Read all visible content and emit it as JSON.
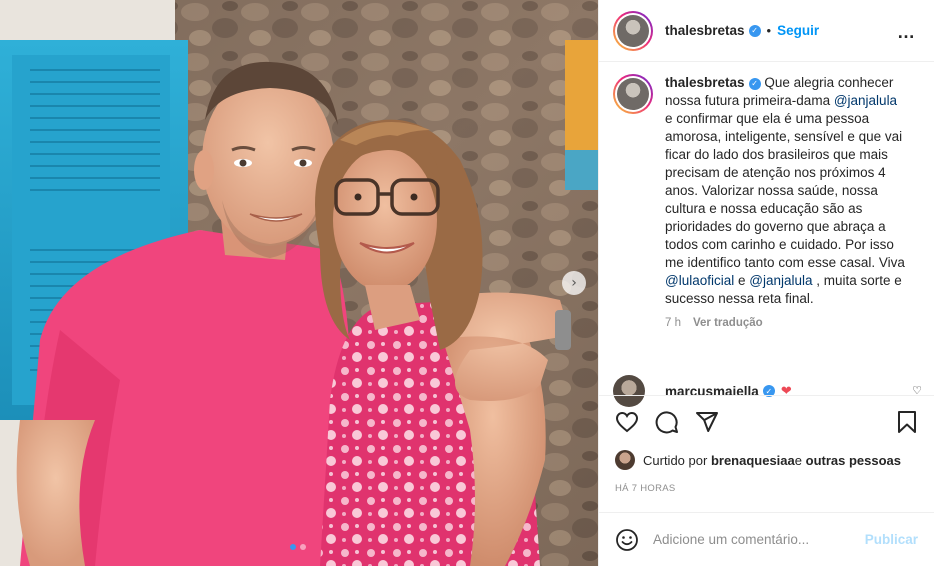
{
  "header": {
    "username": "thalesbretas",
    "separator": "•",
    "follow_label": "Seguir",
    "more_icon": "…"
  },
  "caption": {
    "username": "thalesbretas",
    "text_1": "Que alegria conhecer nossa futura primeira-dama ",
    "mention_1": "@janjalula",
    "text_2": " e confirmar que ela é uma pessoa amorosa, inteligente, sensível e que vai ficar do lado dos brasileiros que mais precisam de atenção nos próximos 4 anos. Valorizar nossa saúde, nossa cultura e nossa educação são as prioridades do governo que abraça a todos com carinho e cuidado. Por isso me identifico tanto com esse casal. Viva ",
    "mention_2": "@lulaoficial",
    "text_3": " e ",
    "mention_3": "@janjalula",
    "text_4": " , muita sorte e sucesso nessa reta final.",
    "time": "7 h",
    "translate_label": "Ver tradução"
  },
  "comment": {
    "username": "marcusmaiella",
    "heart": "❤"
  },
  "likes": {
    "prefix": "Curtido por ",
    "user": "brenaquesiaa",
    "middle": " e ",
    "others": "outras pessoas"
  },
  "post_time": "HÁ 7 HORAS",
  "add_comment": {
    "placeholder": "Adicione um comentário...",
    "publish_label": "Publicar"
  },
  "carousel": {
    "next_icon": "›",
    "total_slides": 2,
    "active_slide": 1
  },
  "colors": {
    "accent": "#0095f6",
    "verified": "#3897f0",
    "mention": "#00376b",
    "publish_disabled": "#b2dffc",
    "heart": "#ed4956"
  }
}
